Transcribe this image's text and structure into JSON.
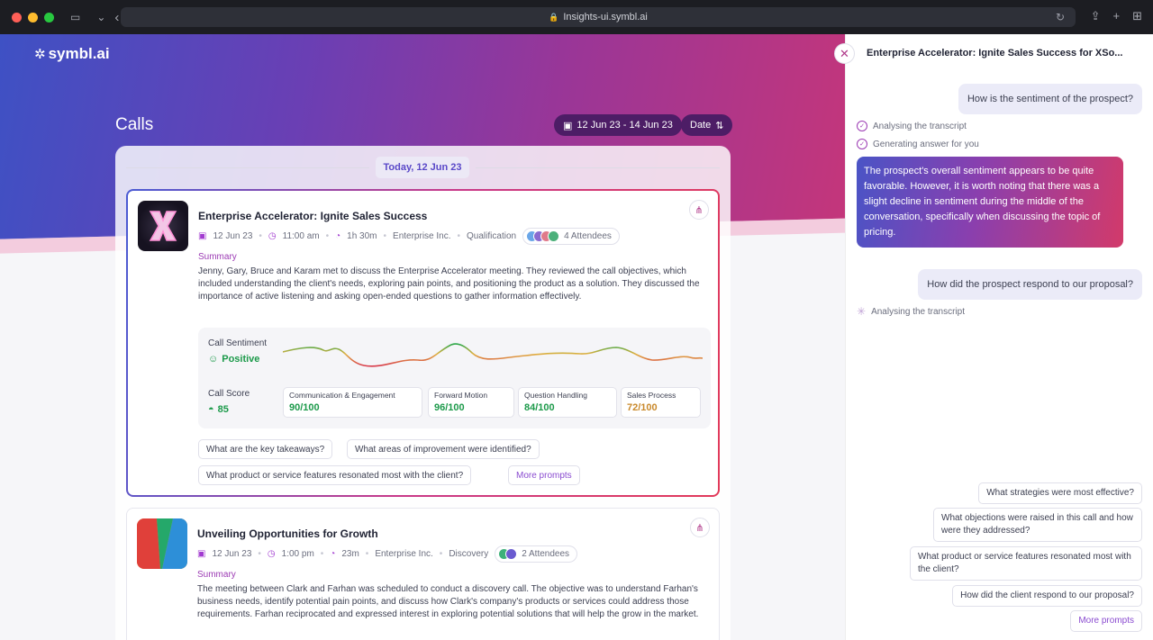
{
  "browser": {
    "url": "Insights-ui.symbl.ai"
  },
  "app": {
    "logo_text": "symbl.ai",
    "page_title": "Calls",
    "date_range": "12 Jun 23 - 14 Jun 23",
    "sort_label": "Date"
  },
  "feed": {
    "day_label": "Today, 12 Jun 23"
  },
  "call1": {
    "title": "Enterprise Accelerator: Ignite Sales Success",
    "date": "12 Jun 23",
    "time": "11:00 am",
    "duration": "1h 30m",
    "company": "Enterprise Inc.",
    "stage": "Qualification",
    "attendees": "4 Attendees",
    "summary_label": "Summary",
    "summary": "Jenny, Gary, Bruce and Karam met to discuss the Enterprise Accelerator meeting. They reviewed the call objectives, which included understanding the client's needs, exploring pain points, and positioning the product as a solution. They discussed the importance of active listening and asking open-ended questions to gather information effectively.",
    "sentiment_label": "Call Sentiment",
    "sentiment_value": "Positive",
    "score_label": "Call Score",
    "score_value": "85",
    "scores": [
      {
        "label": "Communication & Engagement",
        "value": "90/100",
        "color": "#1c9a4a"
      },
      {
        "label": "Forward Motion",
        "value": "96/100",
        "color": "#1c9a4a"
      },
      {
        "label": "Question Handling",
        "value": "84/100",
        "color": "#1c9a4a"
      },
      {
        "label": "Sales Process",
        "value": "72/100",
        "color": "#c9892b"
      }
    ],
    "prompts": [
      "What are the key takeaways?",
      "What areas of improvement were identified?",
      "What product or service features resonated most with the client?",
      "More prompts"
    ]
  },
  "call2": {
    "title": "Unveiling Opportunities for Growth",
    "date": "12 Jun 23",
    "time": "1:00 pm",
    "duration": "23m",
    "company": "Enterprise Inc.",
    "stage": "Discovery",
    "attendees": "2 Attendees",
    "summary_label": "Summary",
    "summary": "The meeting between Clark and Farhan was scheduled to conduct a discovery call. The objective was to understand Farhan's business needs, identify potential pain points, and discuss how Clark's company's products or services could address those requirements. Farhan reciprocated and expressed interest in exploring potential solutions that will help the grow in the market."
  },
  "chat": {
    "title": "Enterprise Accelerator: Ignite Sales Success for XSo...",
    "q1": "How is the sentiment of the prospect?",
    "status1": "Analysing the transcript",
    "status2": "Generating answer for you",
    "answer": "The prospect's overall sentiment appears to be quite favorable. However, it is worth noting that there was a slight decline in sentiment during the middle of the conversation, specifically when discussing the topic of pricing.",
    "q2": "How did the prospect respond to our proposal?",
    "status3": "Analysing the transcript",
    "suggestions": [
      "What strategies were most effective?",
      "What objections were raised in this call and how were they addressed?",
      "What product or service features resonated most with the client?",
      "How did the client respond to our proposal?",
      "More prompts"
    ]
  },
  "colors": {
    "accent": "#9c3bb4",
    "positive": "#1c9a4a",
    "warning": "#c9892b"
  }
}
